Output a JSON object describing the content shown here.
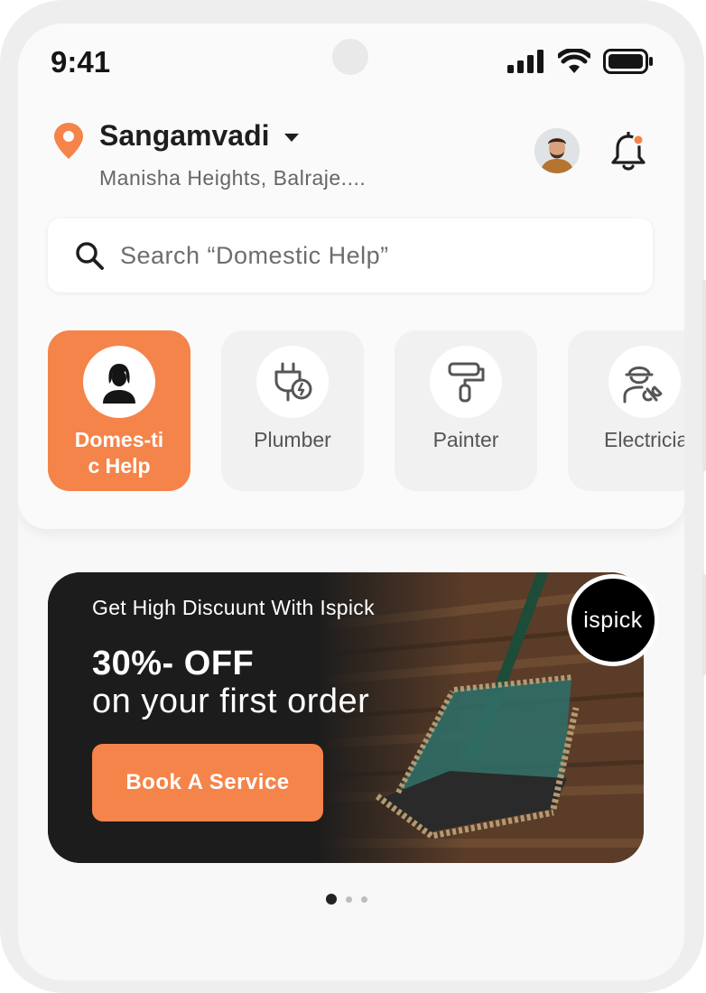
{
  "status_bar": {
    "time": "9:41"
  },
  "location": {
    "city": "Sangamvadi",
    "address": "Manisha Heights, Balraje...."
  },
  "search": {
    "placeholder": "Search “Domestic Help”"
  },
  "categories": [
    {
      "label": "Domes-tic Help",
      "icon": "woman-icon",
      "active": true
    },
    {
      "label": "Plumber",
      "icon": "plug-icon",
      "active": false
    },
    {
      "label": "Painter",
      "icon": "paint-roller-icon",
      "active": false
    },
    {
      "label": "Electricia",
      "icon": "worker-wrench-icon",
      "active": false
    }
  ],
  "banner": {
    "subtitle": "Get High Discuunt With Ispick",
    "headline": "30%- OFF",
    "line": "on your first order",
    "cta": "Book A Service",
    "logo": "ispick"
  },
  "pagination": {
    "pages": 3,
    "current": 1
  },
  "colors": {
    "accent": "#f5844a",
    "text": "#1e1e1e",
    "muted": "#666666"
  }
}
